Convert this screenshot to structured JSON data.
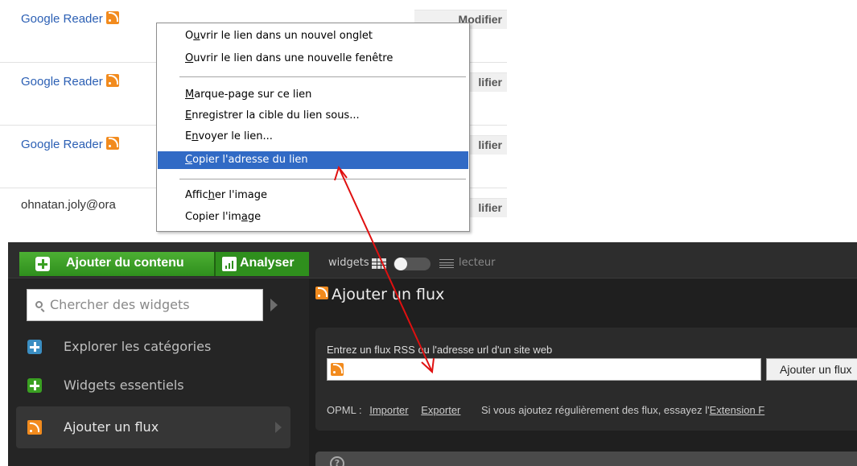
{
  "reader_list": {
    "rows": [
      {
        "name": "Google Reader",
        "button": "Modifier"
      },
      {
        "name": "Google Reader",
        "button": "lifier"
      },
      {
        "name": "Google Reader",
        "button": "lifier"
      },
      {
        "name": "ohnatan.joly@ora",
        "button": "lifier"
      }
    ]
  },
  "context_menu": {
    "items": [
      {
        "pre": "O",
        "key": "u",
        "post": "vrir le lien dans un nouvel onglet"
      },
      {
        "pre": "",
        "key": "O",
        "post": "uvrir le lien dans une nouvelle fenêtre"
      },
      {
        "pre": "",
        "key": "M",
        "post": "arque-page sur ce lien"
      },
      {
        "pre": "",
        "key": "E",
        "post": "nregistrer la cible du lien sous..."
      },
      {
        "pre": "E",
        "key": "n",
        "post": "voyer le lien..."
      },
      {
        "pre": "",
        "key": "C",
        "post": "opier l'adresse du lien"
      },
      {
        "pre": "Affic",
        "key": "h",
        "post": "er l'image"
      },
      {
        "pre": "Copier l'im",
        "key": "a",
        "post": "ge"
      }
    ],
    "highlighted_index": 5,
    "highlight_color": "#316ac5"
  },
  "topbar": {
    "add_content": "Ajouter du contenu",
    "analyse": "Analyser",
    "widgets": "widgets",
    "lecteur": "lecteur"
  },
  "sidebar": {
    "search_placeholder": "Chercher des widgets",
    "items": [
      {
        "label": "Explorer les catégories",
        "icon": "plus-blue-icon"
      },
      {
        "label": "Widgets essentiels",
        "icon": "plus-green-icon"
      },
      {
        "label": "Ajouter un flux",
        "icon": "rss-icon"
      }
    ]
  },
  "main": {
    "title": "Ajouter un flux",
    "input_label": "Entrez un flux RSS ou l'adresse url d'un site web",
    "add_button": "Ajouter un flux",
    "opml_label": "OPML :",
    "import": "Importer",
    "export": "Exporter",
    "hint": "Si vous ajoutez régulièrement des flux, essayez l'",
    "hint_link": "Extension F"
  },
  "colors": {
    "accent_green": "#3aa022",
    "rss_orange": "#f28b1e",
    "arrow_red": "#e01010",
    "link_blue": "#2b5fb4"
  }
}
